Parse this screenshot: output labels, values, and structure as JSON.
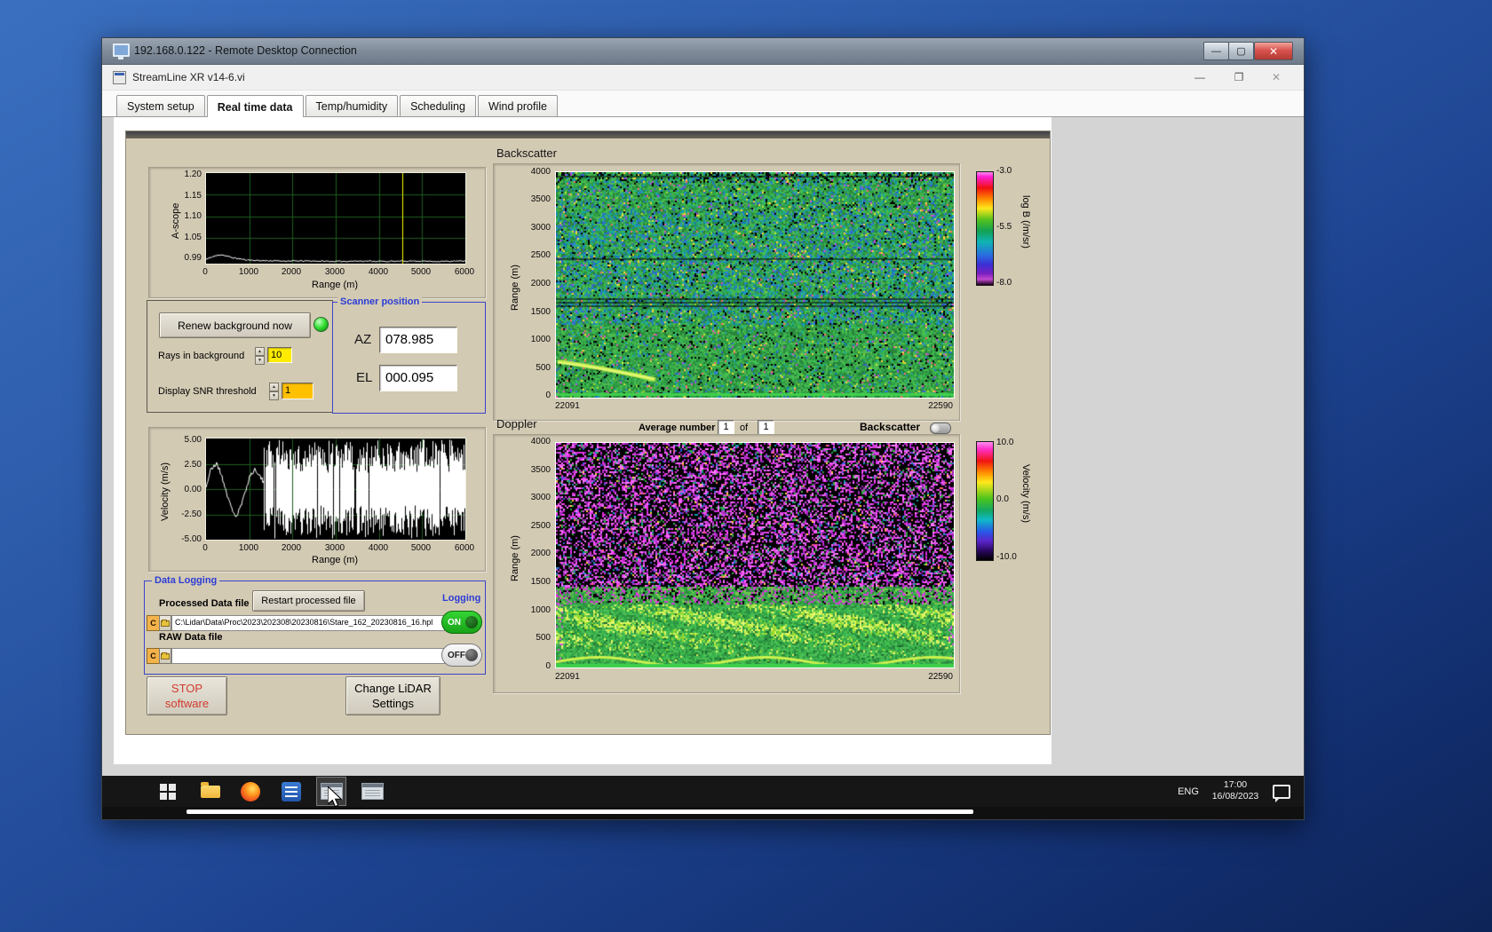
{
  "icons": {
    "minimize": "—",
    "maximize": "▢",
    "restore": "❐",
    "close": "✕",
    "spin_up": "▲",
    "spin_down": "▼"
  },
  "rdp": {
    "title": "192.168.0.122 - Remote Desktop Connection"
  },
  "app": {
    "title": "StreamLine XR v14-6.vi",
    "active_tab": "Real time data",
    "tabs": [
      {
        "label": "System setup"
      },
      {
        "label": "Real time data"
      },
      {
        "label": "Temp/humidity"
      },
      {
        "label": "Scheduling"
      },
      {
        "label": "Wind profile"
      }
    ]
  },
  "ascope": {
    "ylabel": "A-scope",
    "xlabel": "Range (m)",
    "yticks": [
      "1.20",
      "1.15",
      "1.10",
      "1.05",
      "0.99"
    ],
    "xticks": [
      "0",
      "1000",
      "2000",
      "3000",
      "4000",
      "5000",
      "6000"
    ]
  },
  "controls": {
    "renew_button": "Renew background now",
    "rays_label": "Rays in background",
    "rays_value": "10",
    "snr_label": "Display SNR threshold",
    "snr_value": "1"
  },
  "scanner": {
    "title": "Scanner position",
    "az_label": "AZ",
    "az_value": "078.985",
    "el_label": "EL",
    "el_value": "000.095"
  },
  "backscatter": {
    "title": "Backscatter",
    "ylabel": "Range (m)",
    "yticks": [
      "4000",
      "3500",
      "3000",
      "2500",
      "2000",
      "1500",
      "1000",
      "500",
      "0"
    ],
    "x_start": "22091",
    "x_end": "22590",
    "cbar_label": "log B (/m/sr)",
    "cbar_ticks": [
      "-3.0",
      "-5.5",
      "-8.0"
    ]
  },
  "doppler": {
    "title": "Doppler",
    "average_label": "Average number",
    "average_value": "1",
    "of_label": "of",
    "of_value": "1",
    "toggle_label": "Backscatter",
    "ylabel": "Range (m)",
    "yticks": [
      "4000",
      "3500",
      "3000",
      "2500",
      "2000",
      "1500",
      "1000",
      "500",
      "0"
    ],
    "x_start": "22091",
    "x_end": "22590",
    "cbar_label": "Velocity (m/s)",
    "cbar_ticks": [
      "10.0",
      "0.0",
      "-10.0"
    ]
  },
  "velocity": {
    "ylabel": "Velocity (m/s)",
    "xlabel": "Range (m)",
    "yticks": [
      "5.00",
      "2.50",
      "0.00",
      "-2.50",
      "-5.00"
    ],
    "xticks": [
      "0",
      "1000",
      "2000",
      "3000",
      "4000",
      "5000",
      "6000"
    ]
  },
  "logging": {
    "title": "Data Logging",
    "processed_label": "Processed Data file",
    "restart_button": "Restart processed file",
    "logging_label": "Logging",
    "drive": "C",
    "processed_path": "C:\\Lidar\\Data\\Proc\\2023\\202308\\20230816\\Stare_162_20230816_16.hpl",
    "raw_label": "RAW Data file",
    "raw_path": "",
    "on_label": "ON",
    "off_label": "OFF"
  },
  "actions": {
    "stop_line1": "STOP",
    "stop_line2": "software",
    "change_line1": "Change LiDAR",
    "change_line2": "Settings"
  },
  "taskbar": {
    "lang": "ENG",
    "time": "17:00",
    "date": "16/08/2023"
  },
  "chart_data": [
    {
      "id": "ascope",
      "type": "line",
      "title": "A-scope",
      "xlabel": "Range (m)",
      "ylabel": "A-scope",
      "xlim": [
        0,
        6000
      ],
      "ylim": [
        0.99,
        1.2
      ],
      "xticks": [
        0,
        1000,
        2000,
        3000,
        4000,
        5000,
        6000
      ],
      "yticks": [
        1.2,
        1.15,
        1.1,
        1.05,
        0.99
      ],
      "grid": true,
      "bg": "#000000",
      "grid_color": "#1d5c1d",
      "trace_color": "#ffffff",
      "cursor_x": 4550,
      "cursor_color": "#ffff00",
      "noise": 0.003,
      "series": [
        {
          "name": "background",
          "x": [
            0,
            150,
            350,
            600,
            900,
            1200,
            1800,
            2400,
            3000,
            3600,
            4200,
            4800,
            5400,
            6000
          ],
          "y": [
            1.0,
            1.006,
            1.011,
            1.004,
            0.999,
            0.997,
            0.996,
            0.996,
            0.995,
            0.996,
            0.995,
            0.996,
            0.995,
            0.996
          ]
        }
      ]
    },
    {
      "id": "backscatter",
      "type": "heatmap",
      "title": "Backscatter",
      "ylabel": "Range (m)",
      "ylim": [
        0,
        4000
      ],
      "x_start_label": "22091",
      "x_end_label": "22590",
      "colorbar": {
        "label": "log B (/m/sr)",
        "ticks": [
          -3.0,
          -5.5,
          -8.0
        ]
      },
      "features": [
        "speckled green field near log B -5.5",
        "teal/blue band 1300-3300 m",
        "dark strata near 1650-1750 m and 3940 m",
        "bright aerosol streak descending 640 to 320 m over first quarter of record",
        "solid bright return at 0-100 m"
      ]
    },
    {
      "id": "doppler",
      "type": "heatmap",
      "title": "Doppler",
      "ylabel": "Range (m)",
      "ylim": [
        0,
        4000
      ],
      "x_start_label": "22091",
      "x_end_label": "22590",
      "colorbar": {
        "label": "Velocity (m/s)",
        "ticks": [
          10.0,
          0.0,
          -10.0
        ]
      },
      "features": [
        "magenta/black uncorrelated noise above ~1450 m",
        "coherent near-zero velocity green field below ~1200 m",
        "yellow-green streaks 500-1100 m",
        "bright boundary-layer band near surface"
      ]
    },
    {
      "id": "velocity",
      "type": "line",
      "xlabel": "Range (m)",
      "ylabel": "Velocity (m/s)",
      "xlim": [
        0,
        6000
      ],
      "ylim": [
        -5,
        5
      ],
      "xticks": [
        0,
        1000,
        2000,
        3000,
        4000,
        5000,
        6000
      ],
      "yticks": [
        5.0,
        2.5,
        0.0,
        -2.5,
        -5.0
      ],
      "grid": true,
      "bg": "#000000",
      "grid_color": "#1d5c1d",
      "trace_color": "#ffffff",
      "noise": 0.5,
      "noise_start_x": 1350,
      "series": [
        {
          "name": "velocity",
          "x": [
            0,
            100,
            250,
            400,
            550,
            700,
            850,
            1000,
            1150,
            1350
          ],
          "y": [
            0.2,
            1.8,
            2.6,
            0.8,
            -1.5,
            -2.8,
            -1.2,
            1.2,
            2.0,
            0.5
          ]
        }
      ],
      "features": [
        "coherent trace within ±3 m/s below 1350 m",
        "full-scale uncorrelated noise beyond 1350 m"
      ]
    }
  ]
}
